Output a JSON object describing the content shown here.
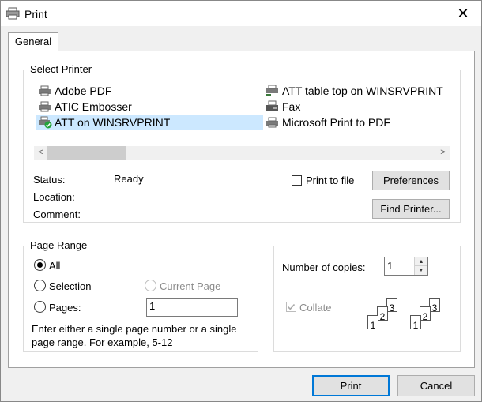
{
  "window": {
    "title": "Print",
    "icon": "printer-icon",
    "close_glyph": "✕"
  },
  "tabs": [
    {
      "label": "General",
      "active": true
    }
  ],
  "select_printer": {
    "group_label": "Select Printer",
    "printers": [
      {
        "name": "Adobe PDF",
        "icon": "printer-icon",
        "selected": false
      },
      {
        "name": "ATIC Embosser",
        "icon": "printer-icon",
        "selected": false
      },
      {
        "name": "ATT on WINSRVPRINT",
        "icon": "network-printer-default-icon",
        "selected": true
      },
      {
        "name": "ATT table top on WINSRVPRINT",
        "icon": "network-printer-icon",
        "selected": false
      },
      {
        "name": "Fax",
        "icon": "fax-icon",
        "selected": false
      },
      {
        "name": "Microsoft Print to PDF",
        "icon": "printer-icon",
        "selected": false
      }
    ],
    "scroll_left": "<",
    "scroll_right": ">"
  },
  "printer_status": {
    "status_label": "Status:",
    "status_value": "Ready",
    "location_label": "Location:",
    "location_value": "",
    "comment_label": "Comment:",
    "comment_value": ""
  },
  "print_to_file": {
    "label": "Print to file",
    "checked": false
  },
  "buttons": {
    "preferences": "Preferences",
    "find_printer": "Find Printer...",
    "print": "Print",
    "cancel": "Cancel"
  },
  "page_range": {
    "group_label": "Page Range",
    "options": {
      "all": "All",
      "selection": "Selection",
      "current_page": "Current Page",
      "pages": "Pages:"
    },
    "selected": "all",
    "pages_value": "1",
    "help_line1": "Enter either a single page number or a single",
    "help_line2": "page range.  For example, 5-12"
  },
  "copies": {
    "label": "Number of copies:",
    "value": "1",
    "collate_label": "Collate",
    "collate_checked": true,
    "collate_enabled": false,
    "sheet_numbers": [
      "1",
      "2",
      "3"
    ]
  },
  "colors": {
    "selection_bg": "#cce8ff",
    "default_button_border": "#0078d7",
    "disabled_text": "#8c8c8c"
  }
}
